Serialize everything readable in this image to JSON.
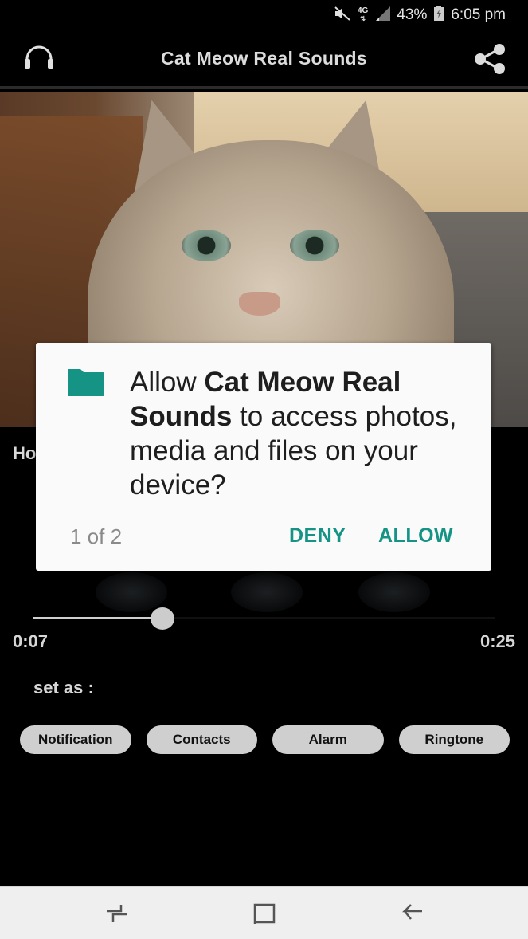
{
  "status_bar": {
    "icons": [
      "mute-icon",
      "network-4g-icon",
      "signal-icon",
      "battery-charging-icon"
    ],
    "network_label": "4G",
    "battery": "43%",
    "time": "6:05 pm"
  },
  "app_bar": {
    "title": "Cat Meow Real Sounds",
    "left_icon": "headphones-icon",
    "right_icon": "share-icon"
  },
  "hero_image": {
    "subject": "cat photo"
  },
  "sound_title_partial": "Ho",
  "player": {
    "progress_fraction": 0.28,
    "current_time": "0:07",
    "total_time": "0:25"
  },
  "set_as": {
    "label": "set as :",
    "options": [
      "Notification",
      "Contacts",
      "Alarm",
      "Ringtone"
    ]
  },
  "permission_dialog": {
    "icon": "folder-icon",
    "icon_color": "#159485",
    "message_prefix": "Allow ",
    "app_name": "Cat Meow Real Sounds",
    "message_suffix": " to access photos, media and files on your device?",
    "counter": "1 of 2",
    "deny_label": "DENY",
    "allow_label": "ALLOW",
    "accent": "#159485"
  },
  "nav_bar": {
    "buttons": [
      "recents-icon",
      "home-icon",
      "back-icon"
    ]
  }
}
